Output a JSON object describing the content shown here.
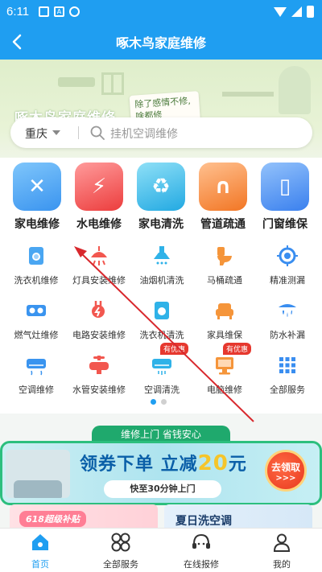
{
  "status_bar": {
    "time": "6:11"
  },
  "header": {
    "title": "啄木鸟家庭维修"
  },
  "hero": {
    "title": "啄木鸟家庭维修",
    "note": "除了感情不修,啥都修"
  },
  "search": {
    "city": "重庆",
    "placeholder": "挂机空调维修"
  },
  "big_categories": [
    {
      "label": "家电维修",
      "icon": "toolbox-icon",
      "color": "#3aa0f5"
    },
    {
      "label": "水电维修",
      "icon": "water-drop-icon",
      "color": "#f24b4b"
    },
    {
      "label": "家电清洗",
      "icon": "spray-bottle-icon",
      "color": "#2bb3e6"
    },
    {
      "label": "管道疏通",
      "icon": "pipe-icon",
      "color": "#f57a2a"
    },
    {
      "label": "门窗维保",
      "icon": "door-icon",
      "color": "#3a86f0"
    }
  ],
  "small_services": [
    {
      "label": "洗衣机维修",
      "icon": "washing-machine-icon"
    },
    {
      "label": "灯具安装维修",
      "icon": "lamp-icon"
    },
    {
      "label": "油烟机清洗",
      "icon": "range-hood-icon"
    },
    {
      "label": "马桶疏通",
      "icon": "toilet-icon"
    },
    {
      "label": "精准测漏",
      "icon": "leak-detect-icon"
    },
    {
      "label": "燃气灶维修",
      "icon": "gas-stove-icon"
    },
    {
      "label": "电路安装维修",
      "icon": "plug-icon"
    },
    {
      "label": "洗衣机清洗",
      "icon": "washer-clean-icon"
    },
    {
      "label": "家具维保",
      "icon": "sofa-icon"
    },
    {
      "label": "防水补漏",
      "icon": "waterproof-icon"
    },
    {
      "label": "空调维修",
      "icon": "air-conditioner-icon"
    },
    {
      "label": "水管安装维修",
      "icon": "faucet-icon"
    },
    {
      "label": "空调清洗",
      "icon": "ac-clean-icon",
      "badge": "有优惠"
    },
    {
      "label": "电脑维修",
      "icon": "computer-icon",
      "badge": "有优惠"
    },
    {
      "label": "全部服务",
      "icon": "grid-icon"
    }
  ],
  "pager": {
    "pages": 2,
    "active": 1
  },
  "promo": {
    "tab": "维修上门  省钱安心",
    "headline_prefix": "领券下单  立减",
    "headline_amount": "20",
    "headline_suffix": "元",
    "subtitle": "快至30分钟上门",
    "claim_label": "去领取",
    "claim_arrows": ">>>"
  },
  "cards": {
    "left": "618超级补贴",
    "right": "夏日洗空调"
  },
  "bottom_nav": [
    {
      "label": "首页",
      "icon": "home-icon",
      "active": true
    },
    {
      "label": "全部服务",
      "icon": "all-services-icon",
      "active": false
    },
    {
      "label": "在线报修",
      "icon": "headset-icon",
      "active": false
    },
    {
      "label": "我的",
      "icon": "user-icon",
      "active": false
    }
  ],
  "colors": {
    "primary": "#1f9ef1",
    "promo_green": "#1fa96d",
    "accent_red": "#e6382e",
    "annotation": "#d8282d"
  }
}
